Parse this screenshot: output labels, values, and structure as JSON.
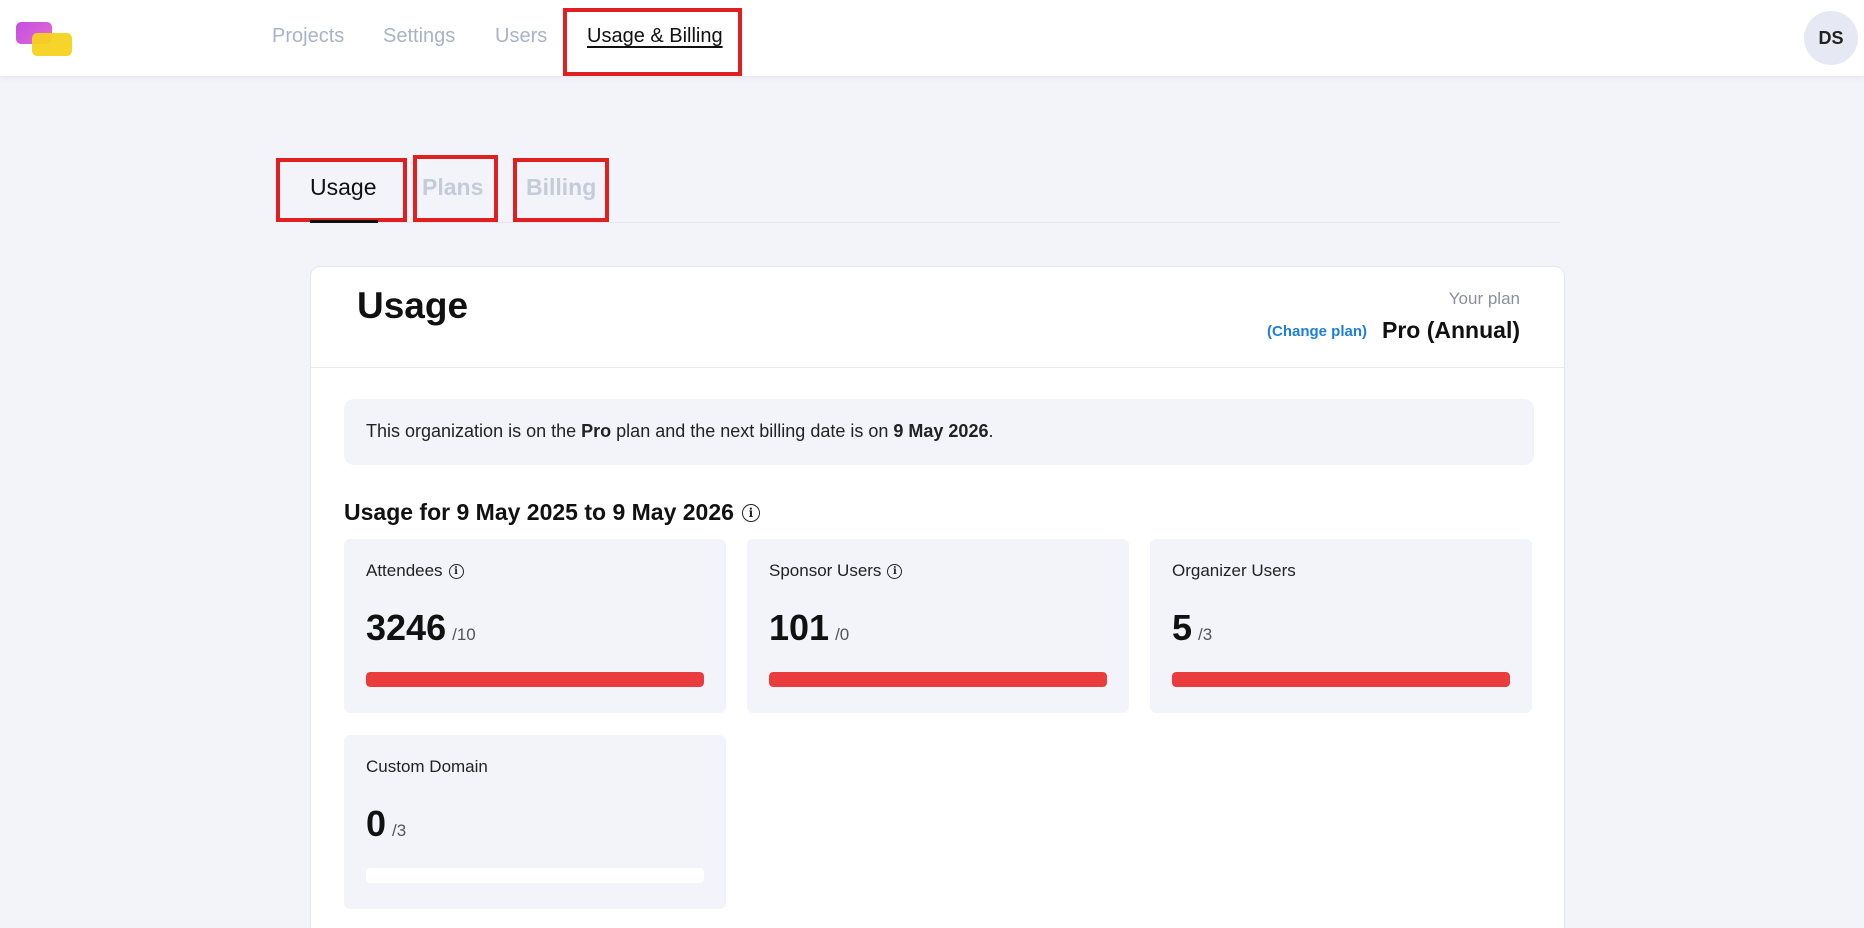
{
  "nav": {
    "items": [
      {
        "label": "Projects"
      },
      {
        "label": "Settings"
      },
      {
        "label": "Users"
      },
      {
        "label": "Usage & Billing"
      }
    ],
    "avatar_initials": "DS"
  },
  "subtabs": [
    {
      "label": "Usage"
    },
    {
      "label": "Plans"
    },
    {
      "label": "Billing"
    }
  ],
  "usage": {
    "title": "Usage",
    "plan_caption": "Your plan",
    "change_plan": "(Change plan)",
    "plan_name": "Pro (Annual)",
    "notice": {
      "prefix": "This organization is on the",
      "plan": "Pro",
      "middle": "plan and the next billing date is on",
      "date": "9 May 2026",
      "suffix": "."
    },
    "period_title": "Usage for 9 May 2025 to 9 May 2026",
    "stats": [
      {
        "label": "Attendees",
        "value": "3246",
        "limit": "/10",
        "fill": 1.0,
        "has_info": true
      },
      {
        "label": "Sponsor Users",
        "value": "101",
        "limit": "/0",
        "fill": 1.0,
        "has_info": true
      },
      {
        "label": "Organizer Users",
        "value": "5",
        "limit": "/3",
        "fill": 1.0,
        "has_info": false
      },
      {
        "label": "Custom Domain",
        "value": "0",
        "limit": "/3",
        "fill": 0.0,
        "has_info": false
      }
    ]
  },
  "colors": {
    "accent_link": "#1d7fd6",
    "bar_over_limit": "#ea3c3c",
    "highlight_box": "#e02020"
  }
}
